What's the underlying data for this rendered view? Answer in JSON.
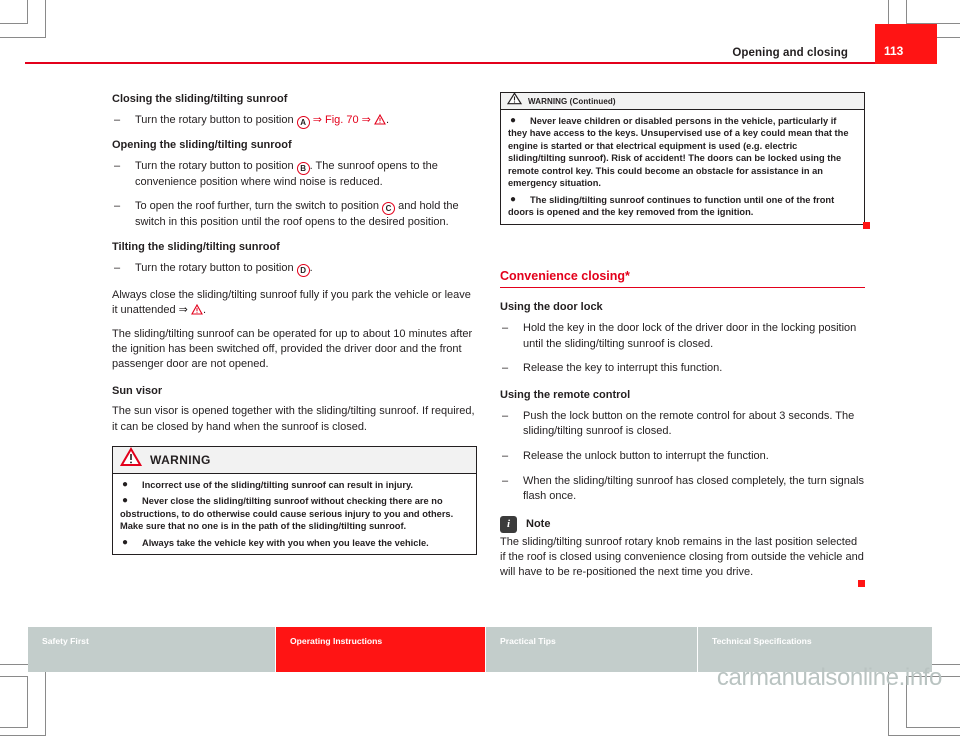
{
  "header": {
    "title": "Opening and closing",
    "page_number": "113",
    "accent_color": "#e3001b",
    "tab_color": "#ff1414"
  },
  "left_column": {
    "section_1": {
      "heading": "Closing the sliding/tilting sunroof",
      "item_dash": "–",
      "item_text_before": "Turn the rotary button to position",
      "marker": "A",
      "item_ref": "⇒ Fig. 70 ⇒",
      "item_text_after": "."
    },
    "section_2": {
      "heading": "Opening the sliding/tilting sunroof",
      "items": [
        {
          "dash": "–",
          "before": "Turn the rotary button to position",
          "marker": "B",
          "after": ". The sunroof opens to the convenience position where wind noise is reduced."
        },
        {
          "dash": "–",
          "before": "To open the roof further, turn the switch to position",
          "marker": "C",
          "after": " and hold the switch in this position until the roof opens to the desired position."
        }
      ]
    },
    "section_3": {
      "heading": "Tilting the sliding/tilting sunroof",
      "dash": "–",
      "before": "Turn the rotary button to position",
      "marker": "D",
      "after": "."
    },
    "paragraph_1_before": "Always close the sliding/tilting sunroof fully if you park the vehicle or leave it unattended ⇒",
    "paragraph_1_after": ".",
    "paragraph_2": "The sliding/tilting sunroof can be operated for up to about 10 minutes after the ignition has been switched off, provided the driver door and the front passenger door are not opened.",
    "sun_visor_heading": "Sun visor",
    "sun_visor_text": "The sun visor is opened together with the sliding/tilting sunroof. If required, it can be closed by hand when the sunroof is closed.",
    "warning_box": {
      "icon": "warning-triangle-icon",
      "title": "WARNING",
      "bullets": [
        "Incorrect use of the sliding/tilting sunroof can result in injury.",
        "Never close the sliding/tilting sunroof without checking there are no obstructions, to do otherwise could cause serious injury to you and others. Make sure that no one is in the path of the sliding/tilting sunroof.",
        "Always take the vehicle key with you when you leave the vehicle."
      ],
      "bullet_glyph": "●"
    }
  },
  "right_column": {
    "warning_continued": {
      "icon": "warning-triangle-icon",
      "title": "WARNING (Continued)",
      "bullets": [
        "Never leave children or disabled persons in the vehicle, particularly if they have access to the keys. Unsupervised use of a key could mean that the engine is started or that electrical equipment is used (e.g. electric sliding/tilting sunroof). Risk of accident! The doors can be locked using the remote control key. This could become an obstacle for assistance in an emergency situation.",
        "The sliding/tilting sunroof continues to function until one of the front doors is opened and the key removed from the ignition."
      ],
      "bullet_glyph": "●"
    },
    "section_heading": "Convenience closing*",
    "door_lock": {
      "heading": "Using the door lock",
      "items": [
        {
          "dash": "–",
          "text": "Hold the key in the door lock of the driver door in the locking position until the sliding/tilting sunroof is closed."
        },
        {
          "dash": "–",
          "text": "Release the key to interrupt this function."
        }
      ]
    },
    "remote_control": {
      "heading": "Using the remote control",
      "items": [
        {
          "dash": "–",
          "text": "Push the lock button on the remote control for about 3 seconds. The sliding/tilting sunroof is closed."
        },
        {
          "dash": "–",
          "text": "Release the unlock button to interrupt the function."
        },
        {
          "dash": "–",
          "text": "When the sliding/tilting sunroof has closed completely, the turn signals flash once."
        }
      ]
    },
    "note": {
      "icon": "info-icon",
      "icon_glyph": "i",
      "title": "Note",
      "text": "The sliding/tilting sunroof rotary knob remains in the last position selected if the roof is closed using convenience closing from outside the vehicle and will have to be re-positioned the next time you drive."
    }
  },
  "footer": {
    "tabs": [
      {
        "label": "Safety First",
        "active": false
      },
      {
        "label": "Operating Instructions",
        "active": true
      },
      {
        "label": "Practical Tips",
        "active": false
      },
      {
        "label": "Technical Specifications",
        "active": false
      }
    ]
  },
  "watermark": "carmanualsonline.info"
}
